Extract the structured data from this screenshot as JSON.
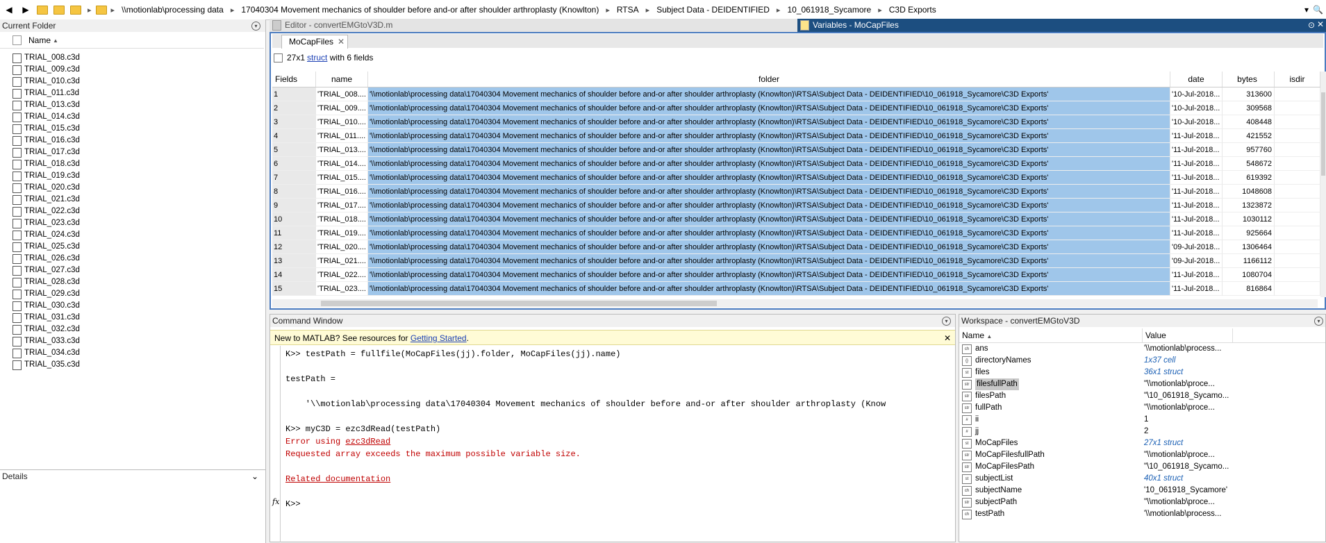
{
  "address_bar": {
    "crumbs": [
      "\\\\motionlab\\processing data",
      "17040304 Movement mechanics of shoulder before and-or after shoulder arthroplasty (Knowlton)",
      "RTSA",
      "Subject Data - DEIDENTIFIED",
      "10_061918_Sycamore",
      "C3D Exports"
    ]
  },
  "current_folder": {
    "title": "Current Folder",
    "column_header": "Name",
    "files": [
      "TRIAL_008.c3d",
      "TRIAL_009.c3d",
      "TRIAL_010.c3d",
      "TRIAL_011.c3d",
      "TRIAL_013.c3d",
      "TRIAL_014.c3d",
      "TRIAL_015.c3d",
      "TRIAL_016.c3d",
      "TRIAL_017.c3d",
      "TRIAL_018.c3d",
      "TRIAL_019.c3d",
      "TRIAL_020.c3d",
      "TRIAL_021.c3d",
      "TRIAL_022.c3d",
      "TRIAL_023.c3d",
      "TRIAL_024.c3d",
      "TRIAL_025.c3d",
      "TRIAL_026.c3d",
      "TRIAL_027.c3d",
      "TRIAL_028.c3d",
      "TRIAL_029.c3d",
      "TRIAL_030.c3d",
      "TRIAL_031.c3d",
      "TRIAL_032.c3d",
      "TRIAL_033.c3d",
      "TRIAL_034.c3d",
      "TRIAL_035.c3d"
    ]
  },
  "details": {
    "title": "Details"
  },
  "editor": {
    "title": "Editor - convertEMGtoV3D.m"
  },
  "variables": {
    "title": "Variables - MoCapFiles",
    "tab": "MoCapFiles",
    "summary_prefix": "27x1 ",
    "summary_link": "struct",
    "summary_suffix": " with 6 fields",
    "headers": {
      "fields": "Fields",
      "name": "name",
      "folder": "folder",
      "date": "date",
      "bytes": "bytes",
      "isdir": "isdir"
    },
    "folder_value": "'\\\\motionlab\\processing data\\17040304 Movement mechanics of shoulder before and-or after shoulder arthroplasty (Knowlton)\\RTSA\\Subject Data - DEIDENTIFIED\\10_061918_Sycamore\\C3D Exports'",
    "rows": [
      {
        "i": "1",
        "name": "'TRIAL_008....",
        "date": "'10-Jul-2018...",
        "bytes": "313600"
      },
      {
        "i": "2",
        "name": "'TRIAL_009....",
        "date": "'10-Jul-2018...",
        "bytes": "309568"
      },
      {
        "i": "3",
        "name": "'TRIAL_010....",
        "date": "'10-Jul-2018...",
        "bytes": "408448"
      },
      {
        "i": "4",
        "name": "'TRIAL_011....",
        "date": "'11-Jul-2018...",
        "bytes": "421552"
      },
      {
        "i": "5",
        "name": "'TRIAL_013....",
        "date": "'11-Jul-2018...",
        "bytes": "957760"
      },
      {
        "i": "6",
        "name": "'TRIAL_014....",
        "date": "'11-Jul-2018...",
        "bytes": "548672"
      },
      {
        "i": "7",
        "name": "'TRIAL_015....",
        "date": "'11-Jul-2018...",
        "bytes": "619392"
      },
      {
        "i": "8",
        "name": "'TRIAL_016....",
        "date": "'11-Jul-2018...",
        "bytes": "1048608"
      },
      {
        "i": "9",
        "name": "'TRIAL_017....",
        "date": "'11-Jul-2018...",
        "bytes": "1323872"
      },
      {
        "i": "10",
        "name": "'TRIAL_018....",
        "date": "'11-Jul-2018...",
        "bytes": "1030112"
      },
      {
        "i": "11",
        "name": "'TRIAL_019....",
        "date": "'11-Jul-2018...",
        "bytes": "925664"
      },
      {
        "i": "12",
        "name": "'TRIAL_020....",
        "date": "'09-Jul-2018...",
        "bytes": "1306464"
      },
      {
        "i": "13",
        "name": "'TRIAL_021....",
        "date": "'09-Jul-2018...",
        "bytes": "1166112"
      },
      {
        "i": "14",
        "name": "'TRIAL_022....",
        "date": "'11-Jul-2018...",
        "bytes": "1080704"
      },
      {
        "i": "15",
        "name": "'TRIAL_023....",
        "date": "'11-Jul-2018...",
        "bytes": "816864"
      }
    ]
  },
  "command_window": {
    "title": "Command Window",
    "notice_prefix": "New to MATLAB? See resources for ",
    "notice_link": "Getting Started",
    "notice_suffix": ".",
    "lines": {
      "l1": "K>> testPath = fullfile(MoCapFiles(jj).folder, MoCapFiles(jj).name)",
      "l2": "testPath =",
      "l3": "    '\\\\motionlab\\processing data\\17040304 Movement mechanics of shoulder before and-or after shoulder arthroplasty (Know",
      "l4": "K>> myC3D = ezc3dRead(testPath)",
      "err_prefix": "Error using ",
      "err_link": "ezc3dRead",
      "err_msg": "Requested array exceeds the maximum possible variable size.",
      "related": "Related documentation",
      "prompt": "K>>"
    },
    "fx": "fx"
  },
  "workspace": {
    "title": "Workspace - convertEMGtoV3D",
    "col_name": "Name",
    "col_value": "Value",
    "items": [
      {
        "icon": "ch",
        "name": "ans",
        "value": "'\\\\motionlab\\process..."
      },
      {
        "icon": "{}",
        "name": "directoryNames",
        "value": "1x37 cell"
      },
      {
        "icon": "st",
        "name": "files",
        "value": "36x1 struct"
      },
      {
        "icon": "str",
        "name": "filesfullPath",
        "value": "\"\\\\motionlab\\proce..."
      },
      {
        "icon": "str",
        "name": "filesPath",
        "value": "\"\\10_061918_Sycamo..."
      },
      {
        "icon": "str",
        "name": "fullPath",
        "value": "\"\\\\motionlab\\proce..."
      },
      {
        "icon": "#",
        "name": "ii",
        "value": "1"
      },
      {
        "icon": "#",
        "name": "jj",
        "value": "2"
      },
      {
        "icon": "st",
        "name": "MoCapFiles",
        "value": "27x1 struct"
      },
      {
        "icon": "str",
        "name": "MoCapFilesfullPath",
        "value": "\"\\\\motionlab\\proce..."
      },
      {
        "icon": "str",
        "name": "MoCapFilesPath",
        "value": "\"\\10_061918_Sycamo..."
      },
      {
        "icon": "st",
        "name": "subjectList",
        "value": "40x1 struct"
      },
      {
        "icon": "ch",
        "name": "subjectName",
        "value": "'10_061918_Sycamore'"
      },
      {
        "icon": "str",
        "name": "subjectPath",
        "value": "\"\\\\motionlab\\proce..."
      },
      {
        "icon": "ch",
        "name": "testPath",
        "value": "'\\\\motionlab\\process..."
      }
    ]
  }
}
